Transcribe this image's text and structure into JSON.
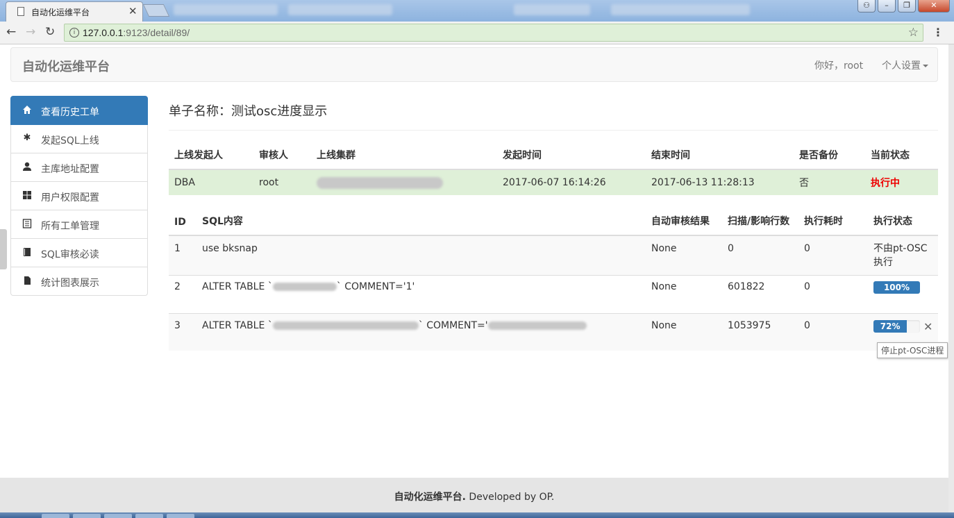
{
  "browser": {
    "tab_title": "自动化运维平台",
    "url_host": "127.0.0.1",
    "url_rest": ":9123/detail/89/"
  },
  "navbar": {
    "brand": "自动化运维平台",
    "greeting": "你好，root",
    "settings": "个人设置"
  },
  "sidebar": {
    "items": [
      {
        "label": "查看历史工单",
        "icon": "home-icon"
      },
      {
        "label": "发起SQL上线",
        "icon": "asterisk-icon"
      },
      {
        "label": "主库地址配置",
        "icon": "user-icon"
      },
      {
        "label": "用户权限配置",
        "icon": "grid-icon"
      },
      {
        "label": "所有工单管理",
        "icon": "list-icon"
      },
      {
        "label": "SQL审核必读",
        "icon": "book-icon"
      },
      {
        "label": "统计图表展示",
        "icon": "file-icon"
      }
    ]
  },
  "page": {
    "title": "单子名称：测试osc进度显示"
  },
  "order_table": {
    "headers": [
      "上线发起人",
      "审核人",
      "上线集群",
      "发起时间",
      "结束时间",
      "是否备份",
      "当前状态"
    ],
    "row": {
      "submitter": "DBA",
      "reviewer": "root",
      "cluster": "",
      "start_time": "2017-06-07 16:14:26",
      "end_time": "2017-06-13 11:28:13",
      "backup": "否",
      "status": "执行中"
    }
  },
  "sql_table": {
    "headers": [
      "ID",
      "SQL内容",
      "自动审核结果",
      "扫描/影响行数",
      "执行耗时",
      "执行状态"
    ],
    "rows": [
      {
        "id": "1",
        "sql": "use bksnap",
        "audit": "None",
        "rows": "0",
        "time": "0",
        "state": "不由pt-OSC执行"
      },
      {
        "id": "2",
        "sql_prefix": "ALTER TABLE `",
        "sql_suffix": "` COMMENT='1'",
        "audit": "None",
        "rows": "601822",
        "time": "0",
        "progress": 100,
        "progress_label": "100%"
      },
      {
        "id": "3",
        "sql_prefix": "ALTER TABLE `",
        "sql_suffix": "` COMMENT='",
        "audit": "None",
        "rows": "1053975",
        "time": "0",
        "progress": 72,
        "progress_label": "72%"
      }
    ],
    "stop_tooltip": "停止pt-OSC进程"
  },
  "footer": {
    "brand": "自动化运维平台.",
    "text": " Developed by OP."
  },
  "colors": {
    "primary": "#337ab7",
    "success_bg": "#dff0d8",
    "danger": "#ee0000"
  }
}
